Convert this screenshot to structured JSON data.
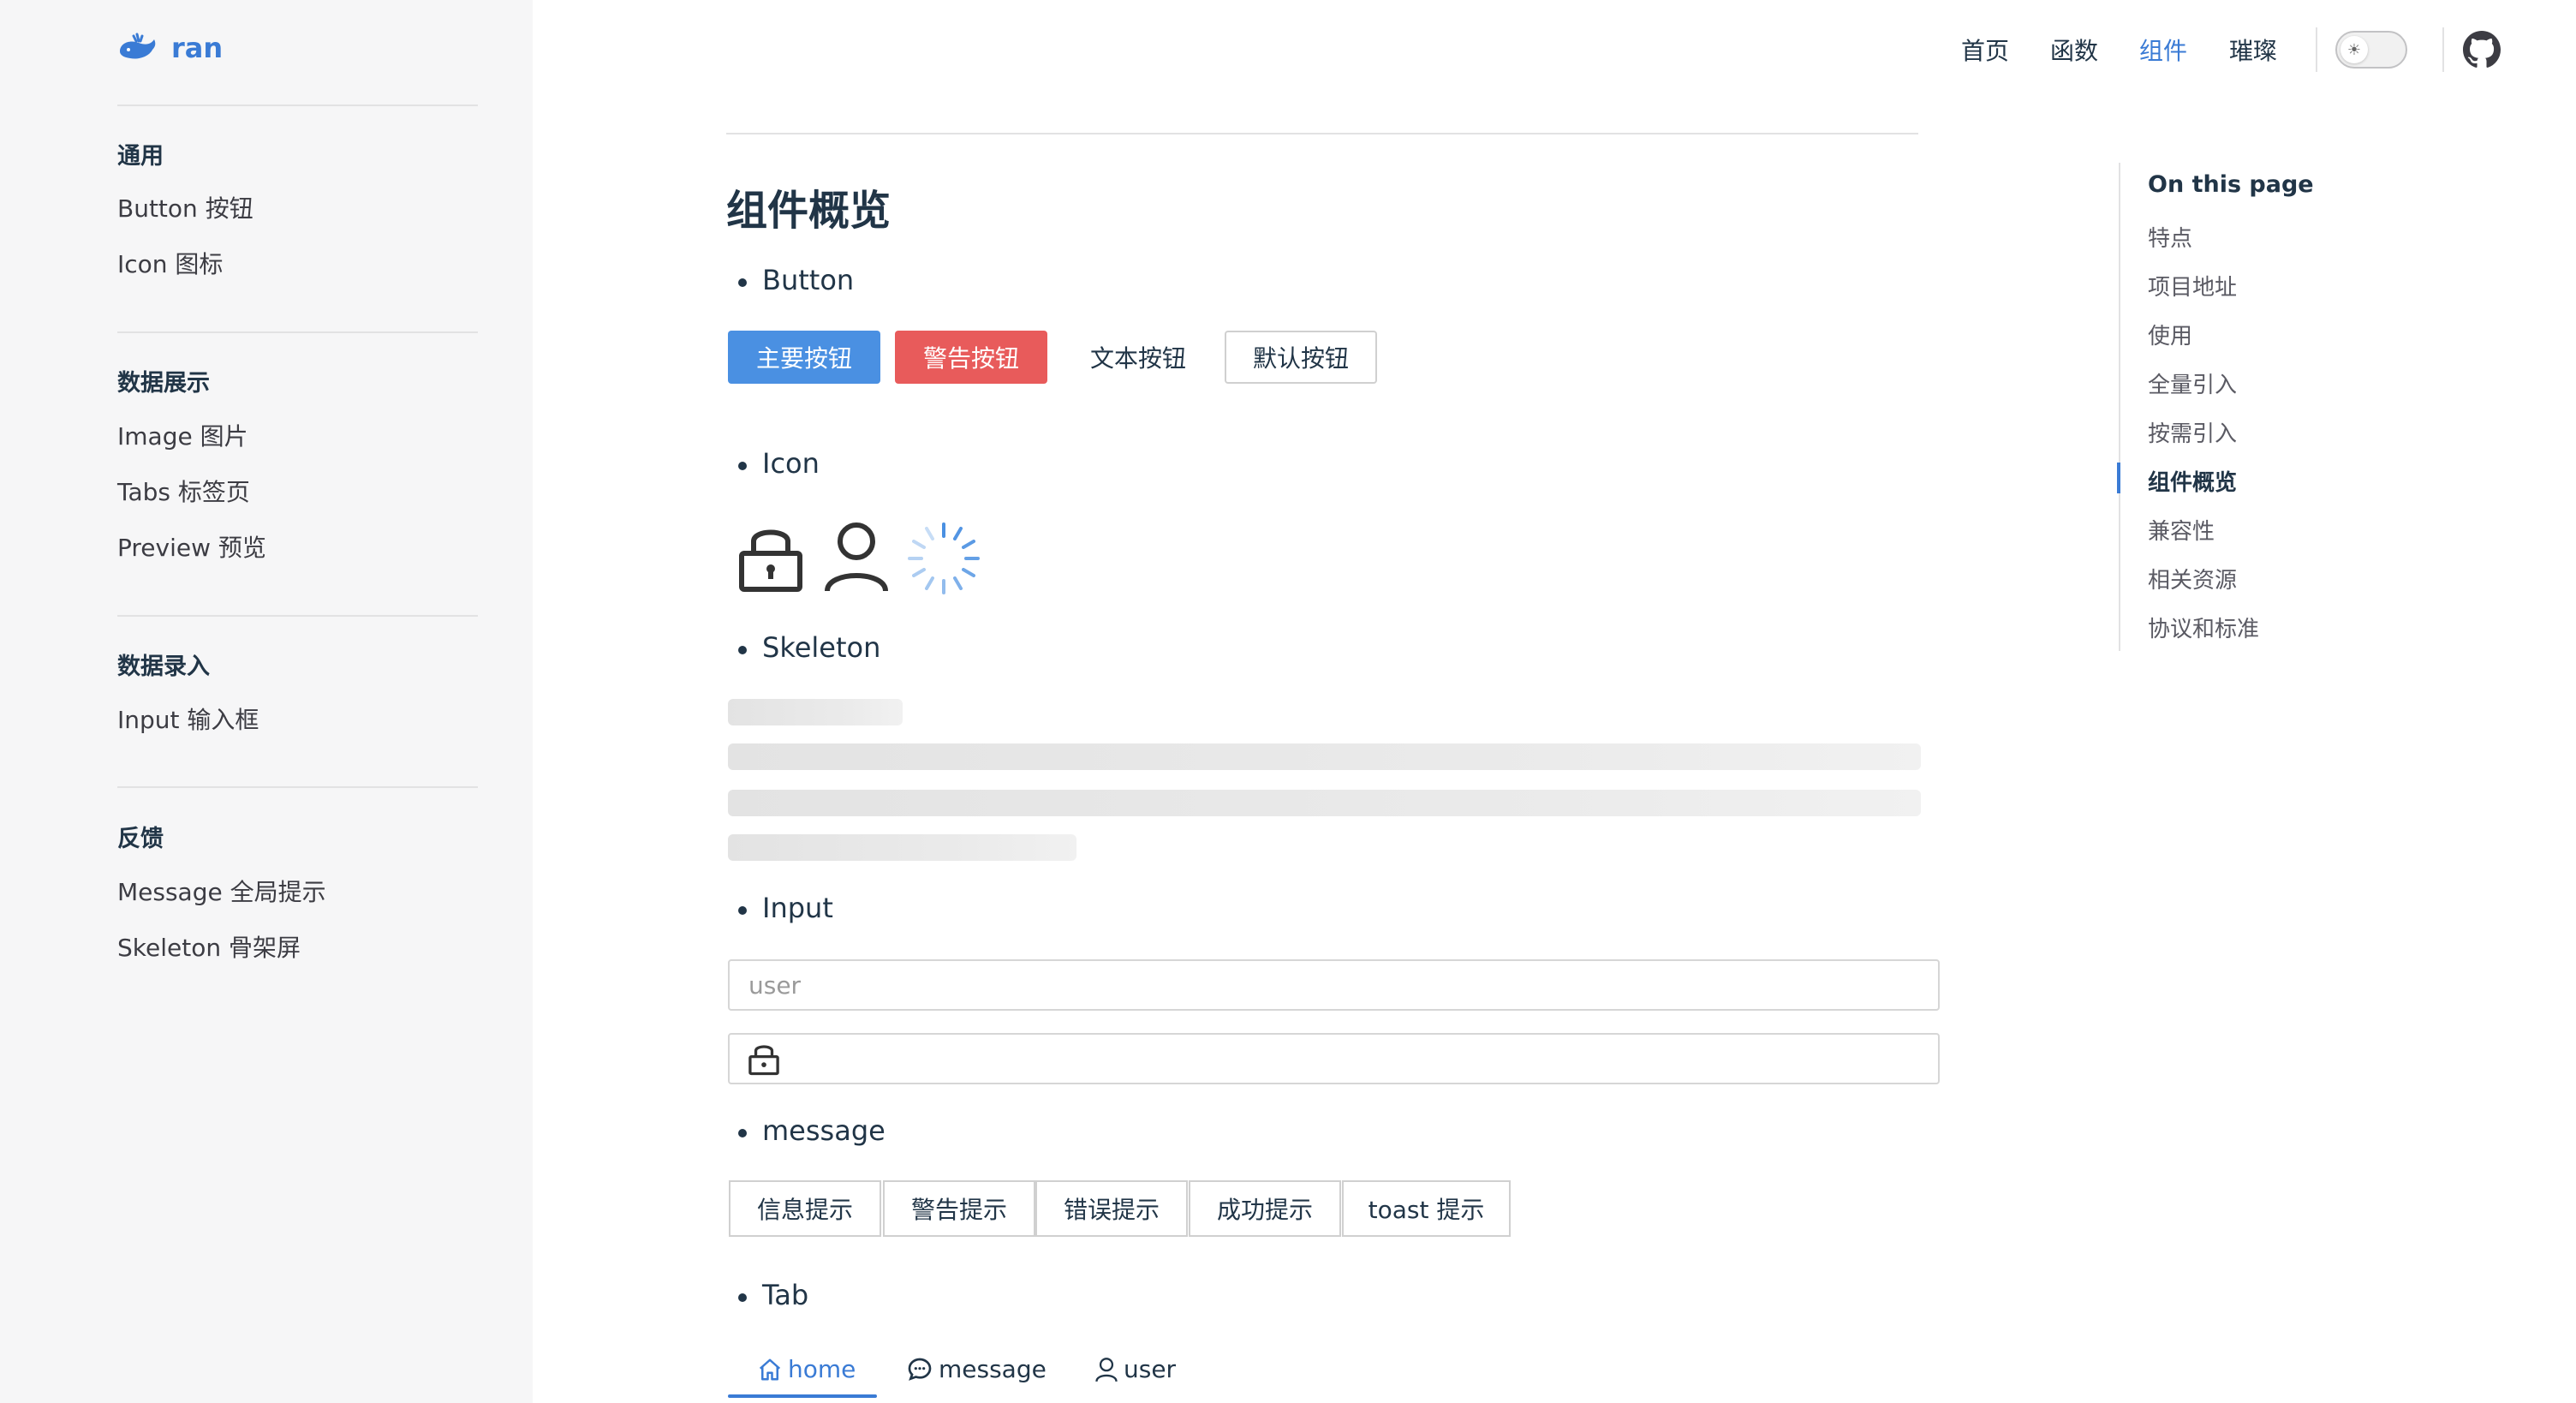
{
  "logo": {
    "text": "ran"
  },
  "sidebar": {
    "groups": [
      {
        "title": "通用",
        "items": [
          "Button 按钮",
          "Icon 图标"
        ]
      },
      {
        "title": "数据展示",
        "items": [
          "Image 图片",
          "Tabs 标签页",
          "Preview 预览"
        ]
      },
      {
        "title": "数据录入",
        "items": [
          "Input 输入框"
        ]
      },
      {
        "title": "反馈",
        "items": [
          "Message 全局提示",
          "Skeleton 骨架屏"
        ]
      }
    ]
  },
  "nav": {
    "items": [
      "首页",
      "函数",
      "组件",
      "璀璨"
    ],
    "active": "组件"
  },
  "page": {
    "title": "组件概览",
    "sections": {
      "button": "Button",
      "icon": "Icon",
      "skeleton": "Skeleton",
      "input": "Input",
      "message": "message",
      "tab": "Tab"
    },
    "buttons": {
      "primary": "主要按钮",
      "warning": "警告按钮",
      "text": "文本按钮",
      "default": "默认按钮"
    },
    "input": {
      "placeholder": "user"
    },
    "message_buttons": [
      "信息提示",
      "警告提示",
      "错误提示",
      "成功提示",
      "toast 提示"
    ],
    "tabs": [
      {
        "label": "home",
        "icon": "home-icon",
        "active": true
      },
      {
        "label": "message",
        "icon": "chat-icon",
        "active": false
      },
      {
        "label": "user",
        "icon": "user-icon",
        "active": false
      }
    ]
  },
  "toc": {
    "title": "On this page",
    "items": [
      "特点",
      "项目地址",
      "使用",
      "全量引入",
      "按需引入",
      "组件概览",
      "兼容性",
      "相关资源",
      "协议和标准"
    ],
    "active": "组件概览"
  },
  "colors": {
    "accent": "#3a7bd5",
    "primary_button": "#4a90e2",
    "warning_button": "#e85b5b",
    "sidebar_bg": "#f6f6f7"
  }
}
